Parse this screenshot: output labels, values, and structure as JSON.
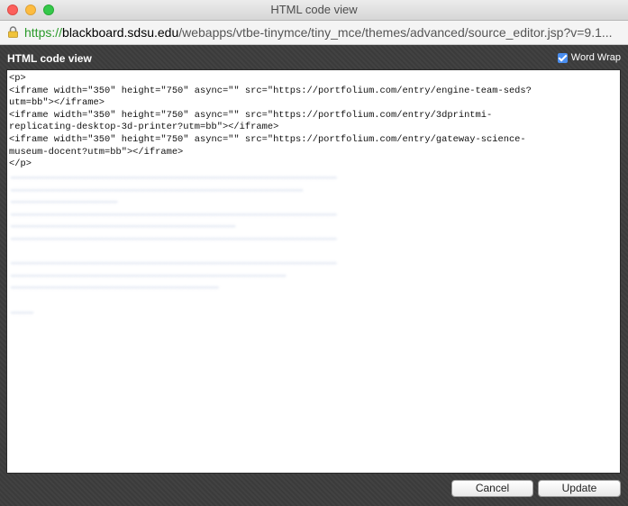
{
  "window": {
    "title": "HTML code view"
  },
  "urlbar": {
    "scheme": "https://",
    "host": "blackboard.sdsu.edu",
    "path": "/webapps/vtbe-tinymce/tiny_mce/themes/advanced/source_editor.jsp?v=9.1..."
  },
  "panel": {
    "title": "HTML code view",
    "word_wrap_label": "Word Wrap",
    "word_wrap_checked": true
  },
  "editor": {
    "lines": [
      "<p>",
      "<iframe width=\"350\" height=\"750\" async=\"\" src=\"https://portfolium.com/entry/engine-team-seds?",
      "utm=bb\"></iframe>",
      "<iframe width=\"350\" height=\"750\" async=\"\" src=\"https://portfolium.com/entry/3dprintmi-",
      "replicating-desktop-3d-printer?utm=bb\"></iframe>",
      "<iframe width=\"350\" height=\"750\" async=\"\" src=\"https://portfolium.com/entry/gateway-science-",
      "museum-docent?utm=bb\"></iframe>",
      "</p>"
    ]
  },
  "buttons": {
    "cancel": "Cancel",
    "update": "Update"
  },
  "colors": {
    "accent": "#4a8ef0",
    "url_scheme": "#2a9a2a"
  }
}
